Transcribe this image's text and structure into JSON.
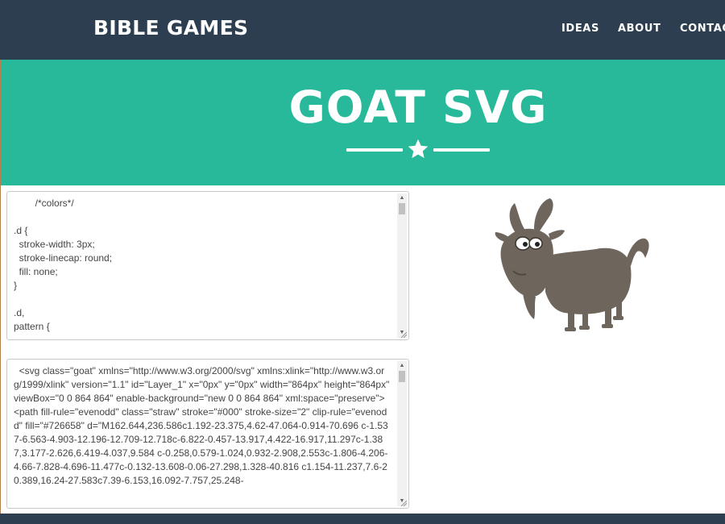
{
  "navbar": {
    "brand": "BIBLE GAMES",
    "links": [
      {
        "label": "IDEAS"
      },
      {
        "label": "ABOUT"
      },
      {
        "label": "CONTACT"
      }
    ]
  },
  "hero": {
    "title": "GOAT SVG",
    "divider_icon": "star-icon"
  },
  "css_editor": {
    "content": "        /*colors*/\n\n.d {\n  stroke-width: 3px;\n  stroke-linecap: round;\n  fill: none;\n}\n\n.d,\npattern {"
  },
  "svg_editor": {
    "content": "  <svg class=\"goat\" xmlns=\"http://www.w3.org/2000/svg\" xmlns:xlink=\"http://www.w3.org/1999/xlink\" version=\"1.1\" id=\"Layer_1\" x=\"0px\" y=\"0px\" width=\"864px\" height=\"864px\" viewBox=\"0 0 864 864\" enable-background=\"new 0 0 864 864\" xml:space=\"preserve\">\n<path fill-rule=\"evenodd\" class=\"straw\" stroke=\"#000\" stroke-size=\"2\" clip-rule=\"evenodd\" fill=\"#726658\" d=\"M162.644,236.586c1.192-23.375,4.62-47.064-0.914-70.696 c-1.537-6.563-4.903-12.196-12.709-12.718c-6.822-0.457-13.917,4.422-16.917,11.297c-1.387,3.177-2.626,6.419-4.037,9.584 c-0.258,0.579-1.024,0.932-2.908,2.553c-1.806-4.206-4.66-7.828-4.696-11.477c-0.132-13.608-0.06-27.298,1.328-40.816 c1.154-11.237,7.6-20.389,16.24-27.583c7.39-6.153,16.092-7.757,25.248-"
  },
  "goat": {
    "icon": "goat-illustration",
    "color": "#6e665c"
  },
  "colors": {
    "navbar": "#2c3e50",
    "hero": "#27b99a"
  }
}
